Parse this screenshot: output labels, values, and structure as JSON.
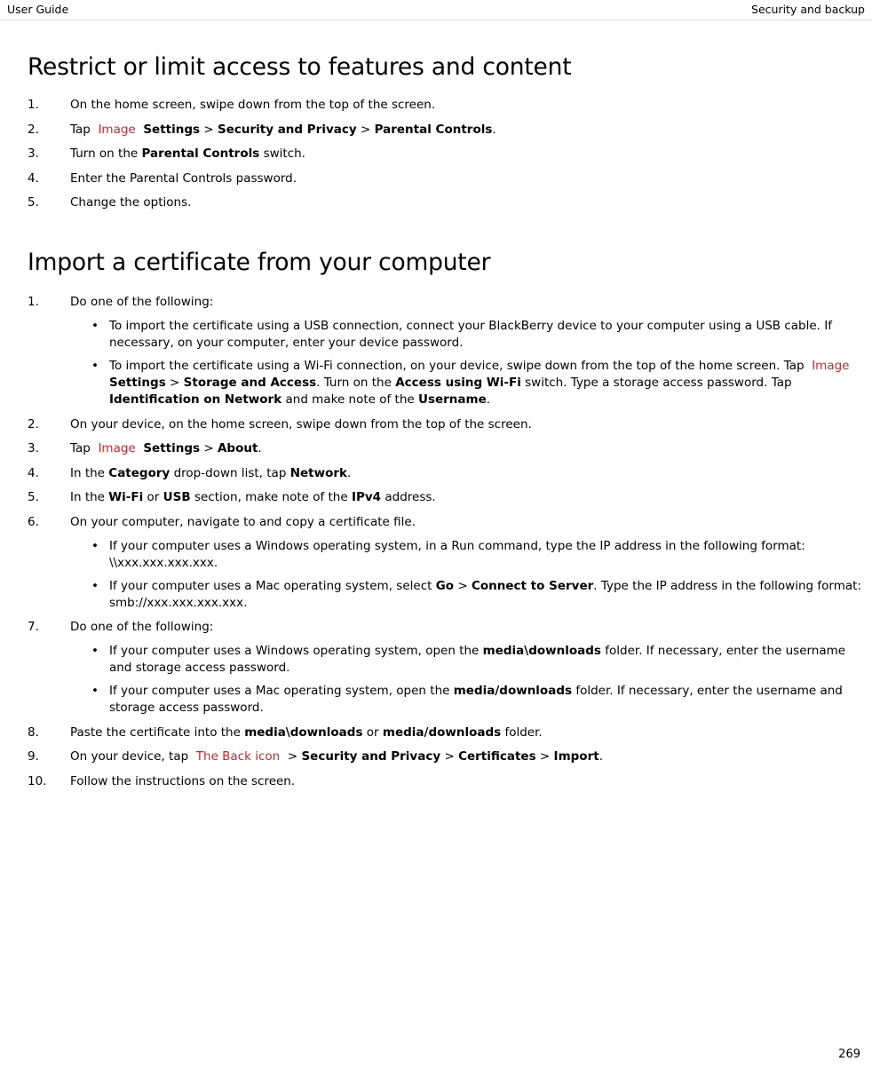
{
  "header": {
    "left": "User Guide",
    "right": "Security and backup"
  },
  "page_number": "269",
  "sections": [
    {
      "title": "Restrict or limit access to features and content",
      "steps": [
        {
          "num": "1.",
          "html": "On the home screen, swipe down from the top of the screen."
        },
        {
          "num": "2.",
          "html": "Tap <span class=\"imgref\">&nbsp;Image&nbsp;</span> <b>Settings</b> &gt; <b>Security and Privacy</b> &gt; <b>Parental Controls</b>."
        },
        {
          "num": "3.",
          "html": "Turn on the <b>Parental Controls</b> switch."
        },
        {
          "num": "4.",
          "html": "Enter the Parental Controls password."
        },
        {
          "num": "5.",
          "html": "Change the options."
        }
      ]
    },
    {
      "title": "Import a certificate from your computer",
      "steps": [
        {
          "num": "1.",
          "html": "Do one of the following:",
          "bullets": [
            "To import the certificate using a USB connection, connect your BlackBerry device to your computer using a USB cable. If necessary, on your computer, enter your device password.",
            "To import the certificate using a Wi-Fi connection, on your device, swipe down from the top of the home screen. Tap <span class=\"imgref\">&nbsp;Image&nbsp;</span> <b>Settings</b> &gt; <b>Storage and Access</b>. Turn on the <b>Access using Wi-Fi</b> switch. Type a storage access password. Tap <b>Identification on Network</b> and make note of the <b>Username</b>."
          ]
        },
        {
          "num": "2.",
          "html": "On your device, on the home screen, swipe down from the top of the screen."
        },
        {
          "num": "3.",
          "html": "Tap <span class=\"imgref\">&nbsp;Image&nbsp;</span> <b>Settings</b> &gt; <b>About</b>."
        },
        {
          "num": "4.",
          "html": "In the <b>Category</b> drop-down list, tap <b>Network</b>."
        },
        {
          "num": "5.",
          "html": "In the <b>Wi-Fi</b> or <b>USB</b> section, make note of the <b>IPv4</b> address."
        },
        {
          "num": "6.",
          "html": "On your computer, navigate to and copy a certificate file.",
          "bullets": [
            "If your computer uses a Windows operating system, in a Run command, type the IP address in the following format: \\\\xxx.xxx.xxx.xxx.",
            "If your computer uses a Mac operating system, select <b>Go</b> &gt; <b>Connect to Server</b>. Type the IP address in the following format: smb://xxx.xxx.xxx.xxx."
          ]
        },
        {
          "num": "7.",
          "html": "Do one of the following:",
          "bullets": [
            "If your computer uses a Windows operating system, open the <b>media\\downloads</b> folder. If necessary, enter the username and storage access password.",
            "If your computer uses a Mac operating system, open the <b>media/downloads</b> folder. If necessary, enter the username and storage access password."
          ]
        },
        {
          "num": "8.",
          "html": "Paste the certificate into the <b>media\\downloads</b> or <b>media/downloads</b> folder."
        },
        {
          "num": "9.",
          "html": "On your device, tap <span class=\"imgref\">&nbsp;The Back icon&nbsp;</span> &gt; <b>Security and Privacy</b> &gt; <b>Certificates</b> &gt; <b>Import</b>."
        },
        {
          "num": "10.",
          "html": "Follow the instructions on the screen."
        }
      ]
    }
  ]
}
